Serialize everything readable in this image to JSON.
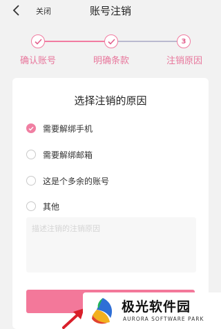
{
  "nav": {
    "close_label": "关闭",
    "title": "账号注销"
  },
  "steps": {
    "items": [
      {
        "label": "确认账号",
        "status": "done"
      },
      {
        "label": "明确条款",
        "status": "done"
      },
      {
        "label": "注销原因",
        "status": "current",
        "number": "3"
      }
    ]
  },
  "card": {
    "title": "选择注销的原因",
    "options": [
      {
        "label": "需要解绑手机",
        "checked": true
      },
      {
        "label": "需要解绑邮箱",
        "checked": false
      },
      {
        "label": "这是个多余的账号",
        "checked": false
      },
      {
        "label": "其他",
        "checked": false
      }
    ],
    "reason_placeholder": "描述注销的注销原因",
    "submit_label": ""
  },
  "watermark": {
    "title": "极光软件园",
    "subtitle": "AURORA SOFTWARE PARK"
  },
  "colors": {
    "accent": "#f3789a",
    "step_line_done": "#f17ba0",
    "step_line_pending": "#b9b9cf"
  }
}
